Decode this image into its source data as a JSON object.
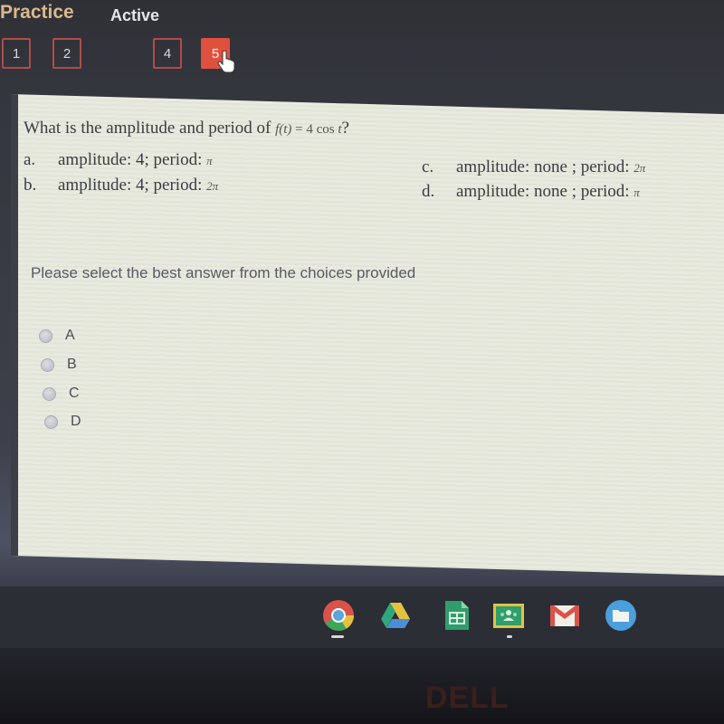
{
  "header": {
    "title": "Practice",
    "status": "Active",
    "question_nav": [
      {
        "label": "1",
        "current": false
      },
      {
        "label": "2",
        "current": false
      },
      {
        "label": "4",
        "current": false
      },
      {
        "label": "5",
        "current": true
      }
    ]
  },
  "question": {
    "prompt": "What is the amplitude and period of ",
    "function_lhs": "f(t)",
    "function_eq": " = 4 ",
    "function_cos": "cos",
    "function_var": " t",
    "qmark": "?",
    "choices": [
      {
        "letter": "a.",
        "text": "amplitude: 4; period: ",
        "period": "π"
      },
      {
        "letter": "b.",
        "text": "amplitude: 4; period: ",
        "period": "2π"
      },
      {
        "letter": "c.",
        "text": "amplitude: none ; period: ",
        "period": "2π"
      },
      {
        "letter": "d.",
        "text": "amplitude: none ; period: ",
        "period": "π"
      }
    ]
  },
  "instruction": "Please select the best answer from the choices provided",
  "answers": [
    {
      "label": "A",
      "selected": false
    },
    {
      "label": "B",
      "selected": false
    },
    {
      "label": "C",
      "selected": false
    },
    {
      "label": "D",
      "selected": false
    }
  ],
  "shelf": {
    "apps": [
      "chrome-icon",
      "google-drive-icon",
      "google-sheets-icon",
      "google-classroom-icon",
      "gmail-icon",
      "files-icon"
    ]
  },
  "bezel": {
    "brand": "DELL"
  },
  "colors": {
    "accent": "#e0503e",
    "nav_border": "#b24a48",
    "title": "#d9b98c"
  }
}
